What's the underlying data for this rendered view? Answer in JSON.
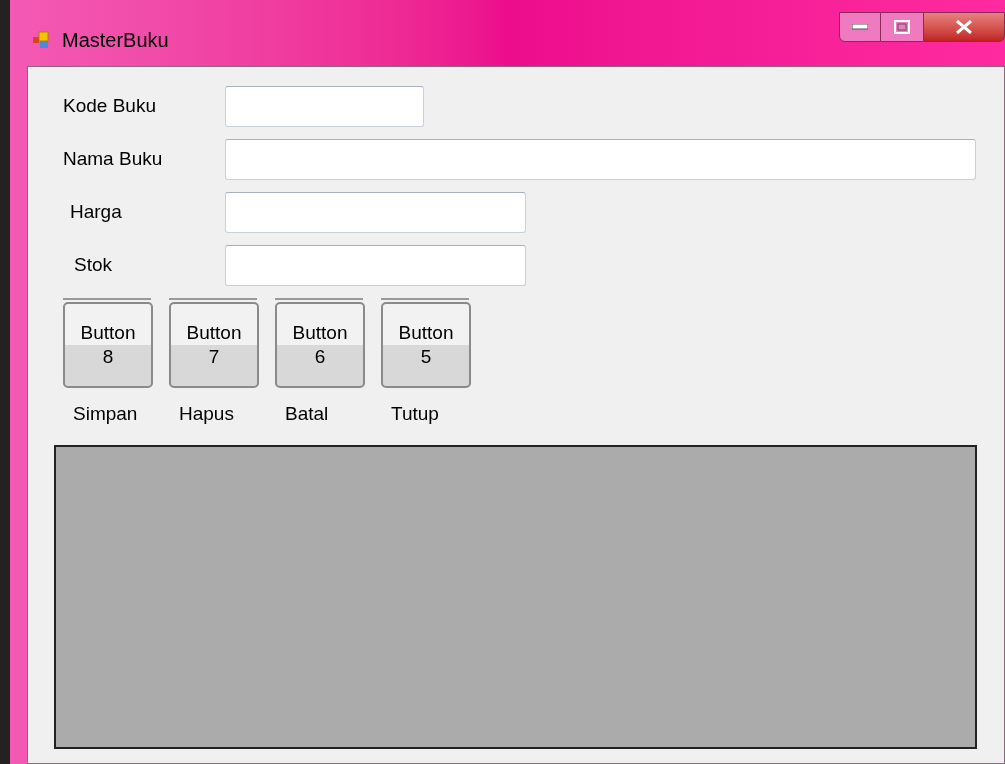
{
  "window": {
    "title": "MasterBuku"
  },
  "fields": [
    {
      "label": "Kode Buku"
    },
    {
      "label": "Nama Buku"
    },
    {
      "label": "Harga"
    },
    {
      "label": "Stok"
    }
  ],
  "buttons": [
    {
      "label": "Button 8",
      "caption": "Simpan"
    },
    {
      "label": "Button 7",
      "caption": "Hapus"
    },
    {
      "label": "Button 6",
      "caption": "Batal"
    },
    {
      "label": "Button 5",
      "caption": "Tutup"
    }
  ]
}
